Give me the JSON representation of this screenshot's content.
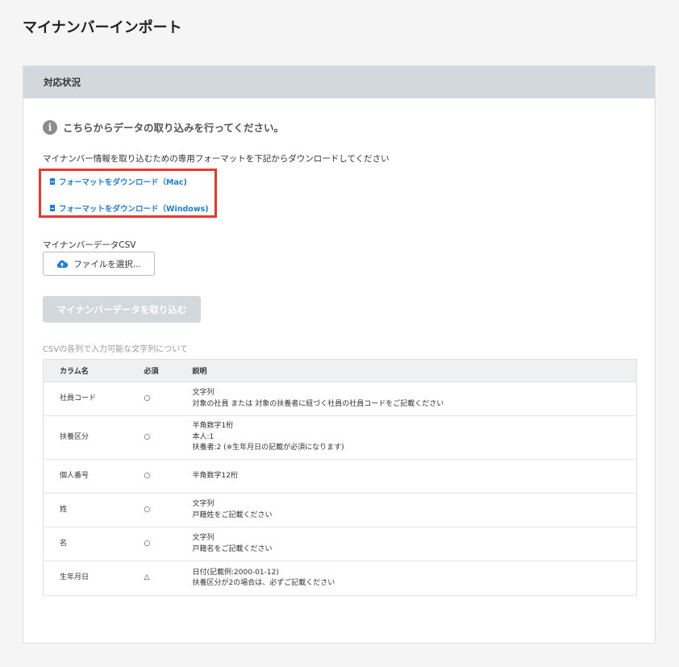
{
  "page": {
    "title": "マイナンバーインポート"
  },
  "card": {
    "header": "対応状況",
    "notice": "こちらからデータの取り込みを行ってください。",
    "description": "マイナンバー情報を取り込むための専用フォーマットを下記からダウンロードしてください",
    "download_mac": "フォーマットをダウンロード（Mac)",
    "download_windows": "フォーマットをダウンロード（Windows)",
    "csv_label": "マイナンバーデータCSV",
    "file_button": "ファイルを選択...",
    "import_button": "マイナンバーデータを取り込む",
    "table_caption": "CSVの各列で入力可能な文字列について"
  },
  "table": {
    "headers": [
      "カラム名",
      "必須",
      "説明"
    ],
    "rows": [
      {
        "name": "社員コード",
        "required": "○",
        "desc": [
          "文字列",
          "対象の社員 または 対象の扶養者に紐づく社員の社員コードをご記載ください"
        ]
      },
      {
        "name": "扶養区分",
        "required": "○",
        "desc": [
          "半角数字1桁",
          "本人:1",
          "扶養者:2 (※生年月日の記載が必須になります)"
        ]
      },
      {
        "name": "個人番号",
        "required": "○",
        "desc": [
          "半角数字12桁"
        ]
      },
      {
        "name": "姓",
        "required": "○",
        "desc": [
          "文字列",
          "戸籍姓をご記載ください"
        ]
      },
      {
        "name": "名",
        "required": "○",
        "desc": [
          "文字列",
          "戸籍名をご記載ください"
        ]
      },
      {
        "name": "生年月日",
        "required": "△",
        "desc": [
          "日付(記載例:2000-01-12)",
          "扶養区分が2の場合は、必ずご記載ください"
        ]
      }
    ]
  },
  "colors": {
    "link": "#1e7fd6",
    "highlight_border": "#e8392d",
    "header_bg": "#d3d8de",
    "disabled_button": "#d3d8de"
  },
  "icons": {
    "notice": "info-icon",
    "download": "document-icon",
    "upload": "cloud-upload-icon"
  }
}
